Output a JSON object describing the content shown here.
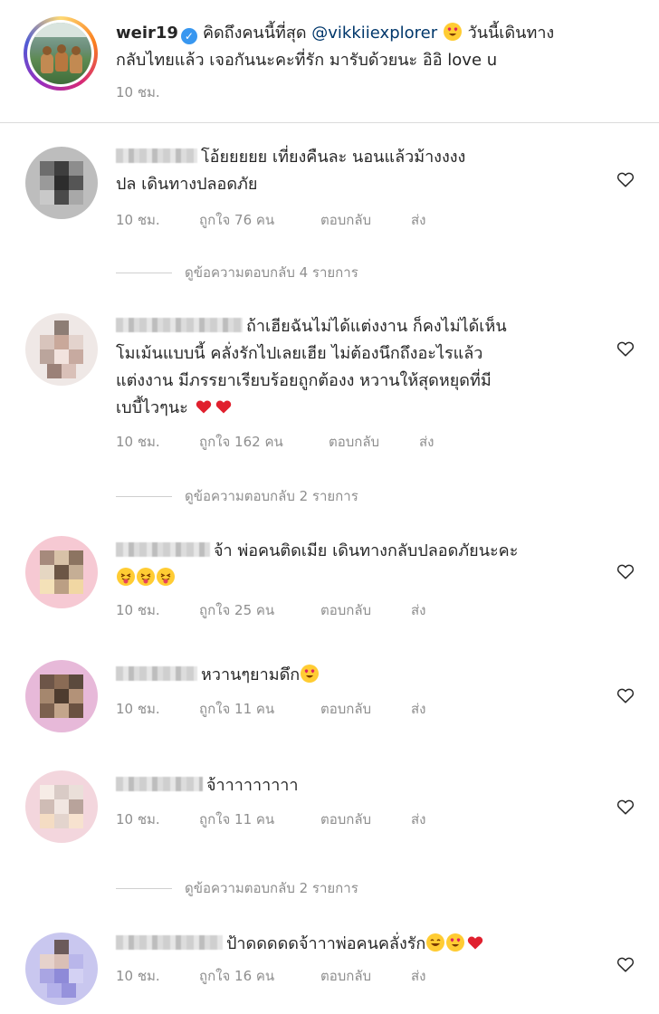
{
  "post": {
    "username": "weir19",
    "caption_before_mention": "คิดถึงคนนี้ที่สุด",
    "mention": "@vikkiiexplorer",
    "caption_after_mention_line1": "วันนี้เดินทาง",
    "caption_line2": "กลับไทยแล้ว เจอกันนะคะที่รัก มารับด้วยนะ อิอิ love u",
    "time": "10 ชม."
  },
  "labels": {
    "reply": "ตอบกลับ",
    "send": "ส่ง"
  },
  "comments": [
    {
      "text_line1": "โอ้ยยยยย เที่ยงคืนละ นอนแล้วม้างงงง",
      "text_line2": "ปล เดินทางปลอดภัย",
      "time": "10 ชม.",
      "likes": "ถูกใจ 76 คน",
      "view_replies": "ดูข้อความตอบกลับ 4 รายการ"
    },
    {
      "text_line1": "ถ้าเฮียฉันไม่ได้แต่งงาน ก็คงไม่ได้เห็น",
      "text_line2": "โมเม้นแบบนี้ คลั่งรักไปเลยเฮีย ไม่ต้องนึกถึงอะไรแล้ว",
      "text_line3": "แต่งงาน มีภรรยาเรียบร้อยถูกต้องง หวานให้สุดหยุดที่มี",
      "text_line4": "เบบี้ไวๆนะ",
      "time": "10 ชม.",
      "likes": "ถูกใจ 162 คน",
      "view_replies": "ดูข้อความตอบกลับ 2 รายการ"
    },
    {
      "text_line1": "จ้า พ่อคนติดเมีย เดินทางกลับปลอดภัยนะคะ",
      "time": "10 ชม.",
      "likes": "ถูกใจ 25 คน"
    },
    {
      "text_line1": "หวานๆยามดึก",
      "time": "10 ชม.",
      "likes": "ถูกใจ 11 คน"
    },
    {
      "text_line1": "จ้าาาาาาาาา",
      "time": "10 ชม.",
      "likes": "ถูกใจ 11 คน",
      "view_replies": "ดูข้อความตอบกลับ 2 รายการ"
    },
    {
      "text_line1": "ป้าดดดดดจ้าาาพ่อคนคลั่งรัก",
      "time": "10 ชม.",
      "likes": "ถูกใจ 16 คน"
    }
  ],
  "colors": {
    "text": "#262626",
    "meta": "#8e8e8e",
    "mention": "#00376b",
    "verified": "#3897f0",
    "divider": "#dbdbdb"
  },
  "icons": [
    "verified-badge-icon",
    "heart-outline-icon",
    "heart-emoji-icon",
    "heart-eyes-emoji-icon",
    "tongue-emoji-icon",
    "grin-emoji-icon"
  ]
}
